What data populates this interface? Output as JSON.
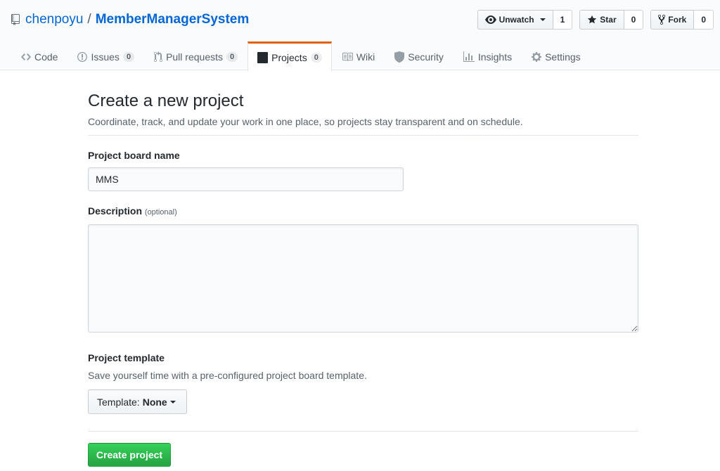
{
  "repo": {
    "owner": "chenpoyu",
    "separator": "/",
    "name": "MemberManagerSystem"
  },
  "actions": {
    "watch": {
      "label": "Unwatch",
      "count": "1"
    },
    "star": {
      "label": "Star",
      "count": "0"
    },
    "fork": {
      "label": "Fork",
      "count": "0"
    }
  },
  "nav": {
    "code": {
      "label": "Code",
      "icon": "code-icon"
    },
    "issues": {
      "label": "Issues",
      "count": "0",
      "icon": "issue-icon"
    },
    "pulls": {
      "label": "Pull requests",
      "count": "0",
      "icon": "pull-request-icon"
    },
    "projects": {
      "label": "Projects",
      "count": "0",
      "icon": "project-icon",
      "selected": true
    },
    "wiki": {
      "label": "Wiki",
      "icon": "book-icon"
    },
    "security": {
      "label": "Security",
      "icon": "shield-icon"
    },
    "insights": {
      "label": "Insights",
      "icon": "graph-icon"
    },
    "settings": {
      "label": "Settings",
      "icon": "gear-icon"
    }
  },
  "page": {
    "title": "Create a new project",
    "subtitle": "Coordinate, track, and update your work in one place, so projects stay transparent and on schedule."
  },
  "form": {
    "name_label": "Project board name",
    "name_value": "MMS",
    "description_label": "Description",
    "description_note": "(optional)",
    "description_value": "",
    "template_label": "Project template",
    "template_note": "Save yourself time with a pre-configured project board template.",
    "template_prefix": "Template:",
    "template_value": "None",
    "submit_label": "Create project"
  },
  "colors": {
    "link": "#0366d6",
    "accent_tab": "#e36209",
    "primary_button": "#28a745"
  }
}
